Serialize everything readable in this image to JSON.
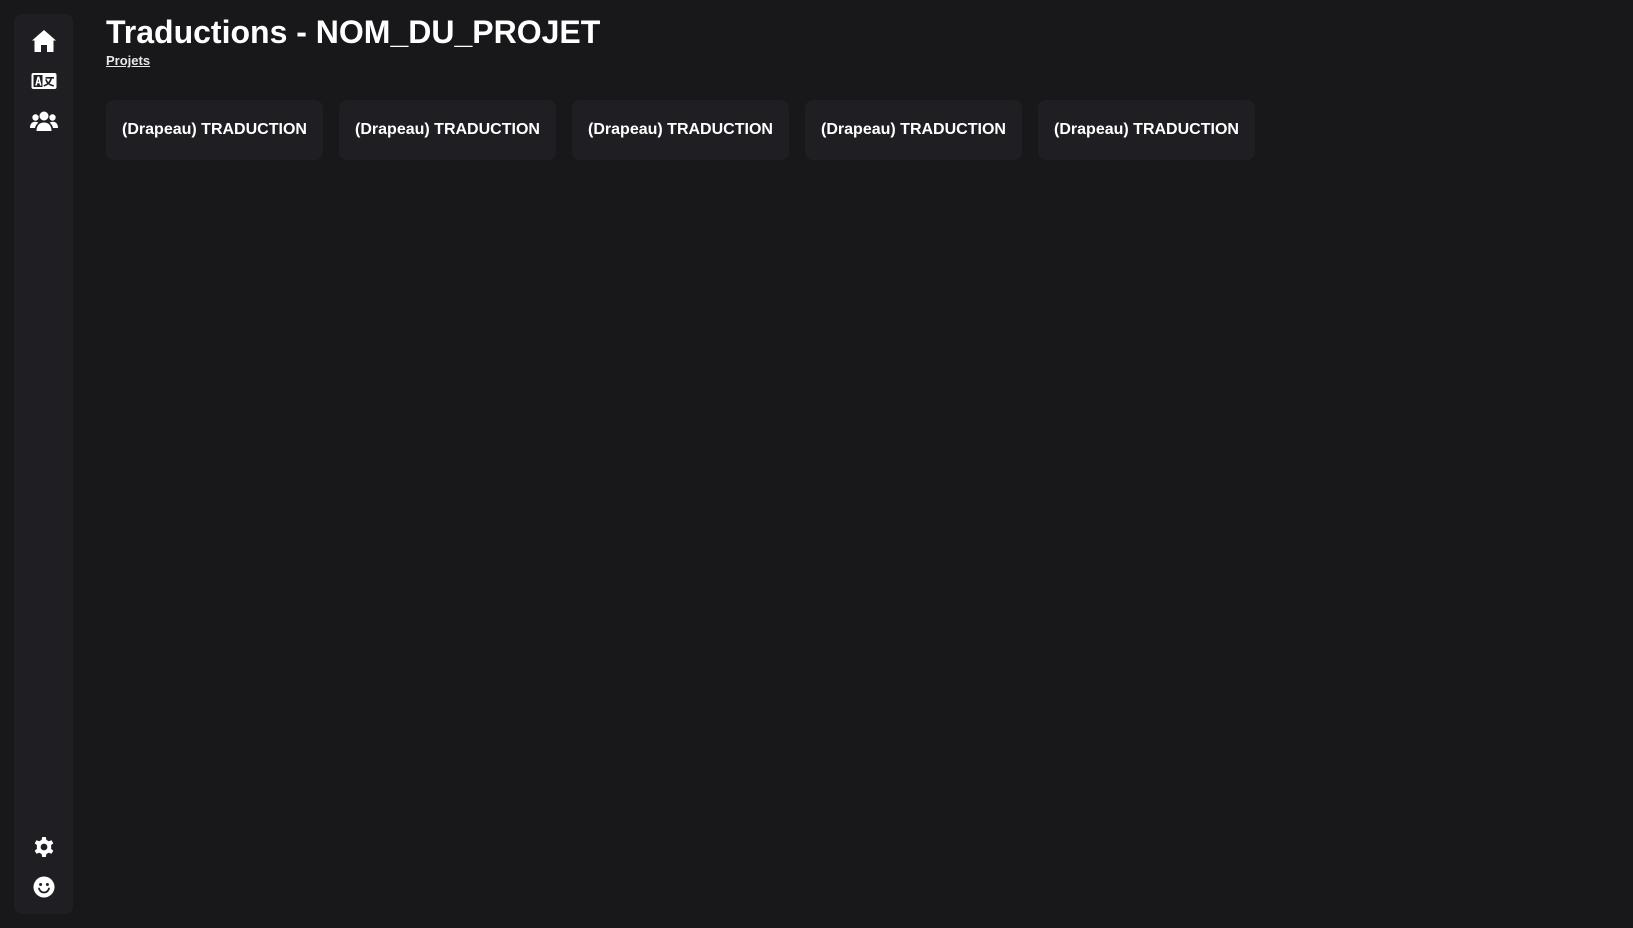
{
  "header": {
    "title": "Traductions - NOM_DU_PROJET",
    "breadcrumb": "Projets"
  },
  "sidebar": {
    "top_items": [
      {
        "icon": "home-icon"
      },
      {
        "icon": "translate-icon"
      },
      {
        "icon": "users-icon"
      }
    ],
    "bottom_items": [
      {
        "icon": "gear-icon"
      },
      {
        "icon": "smiley-icon"
      }
    ]
  },
  "translations": [
    {
      "label": "(Drapeau) TRADUCTION"
    },
    {
      "label": "(Drapeau) TRADUCTION"
    },
    {
      "label": "(Drapeau) TRADUCTION"
    },
    {
      "label": "(Drapeau) TRADUCTION"
    },
    {
      "label": "(Drapeau) TRADUCTION"
    }
  ],
  "colors": {
    "background": "#18181b",
    "panel": "#1f1f23",
    "text": "#ffffff"
  }
}
